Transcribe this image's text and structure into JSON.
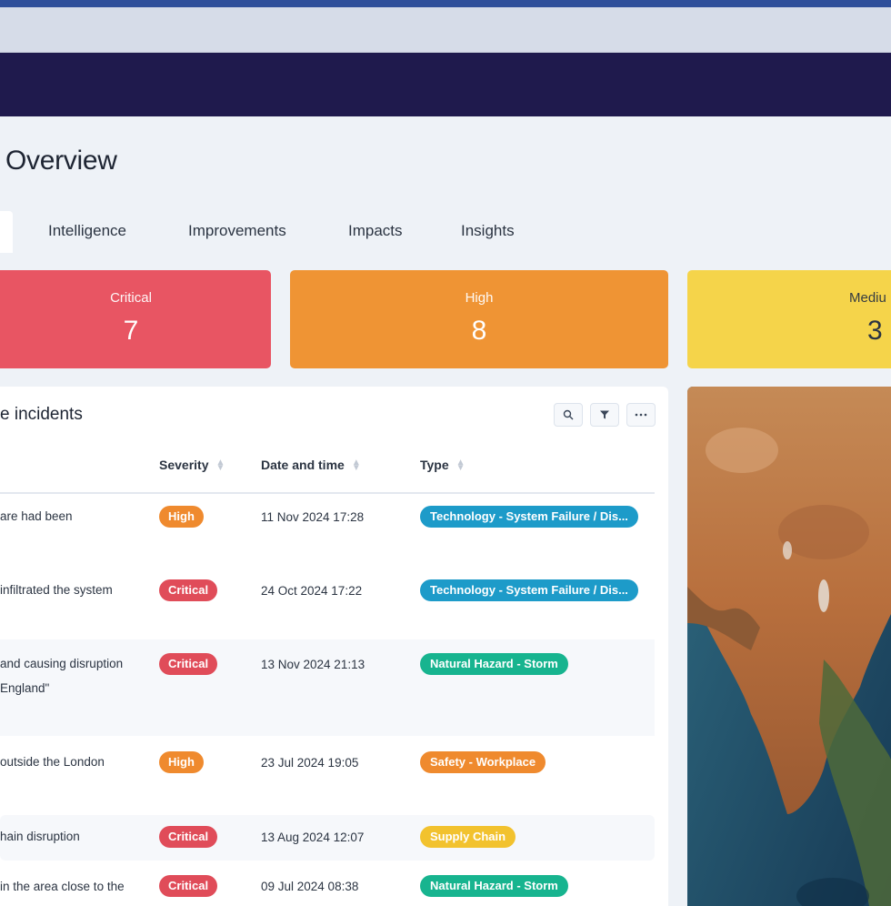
{
  "page": {
    "title": "Overview"
  },
  "tabs": [
    "Intelligence",
    "Improvements",
    "Impacts",
    "Insights"
  ],
  "severity_cards": {
    "critical": {
      "label": "Critical",
      "value": "7",
      "color": "#e85563"
    },
    "high": {
      "label": "High",
      "value": "8",
      "color": "#ef9434"
    },
    "medium": {
      "label": "Mediu",
      "value": "3",
      "color": "#f5d44a"
    }
  },
  "incidents": {
    "title": "e incidents",
    "actions": {
      "search": "search-icon",
      "filter": "filter-icon",
      "more": "more-icon"
    },
    "columns": {
      "severity": "Severity",
      "datetime": "Date and time",
      "type": "Type"
    },
    "rows": [
      {
        "desc1": "are had been",
        "desc2": "",
        "severity": "High",
        "datetime": "11 Nov 2024 17:28",
        "type": "Technology - System Failure / Dis...",
        "type_color": "#1d9bc9"
      },
      {
        "desc1": " infiltrated the system",
        "desc2": "",
        "severity": "Critical",
        "datetime": "24 Oct 2024 17:22",
        "type": "Technology - System Failure / Dis...",
        "type_color": "#1d9bc9"
      },
      {
        "desc1": "and causing disruption",
        "desc2": " England\"",
        "severity": "Critical",
        "datetime": "13 Nov 2024 21:13",
        "type": "Natural Hazard - Storm",
        "type_color": "#17b48f"
      },
      {
        "desc1": " outside the London",
        "desc2": "",
        "severity": "High",
        "datetime": "23 Jul 2024 19:05",
        "type": "Safety - Workplace",
        "type_color": "#ef8a2e"
      },
      {
        "desc1": "hain disruption",
        "desc2": "",
        "severity": "Critical",
        "datetime": "13 Aug 2024 12:07",
        "type": "Supply Chain",
        "type_color": "#f2c22e"
      },
      {
        "desc1": " in the area close to the",
        "desc2": "",
        "severity": "Critical",
        "datetime": "09 Jul 2024 08:38",
        "type": "Natural Hazard - Storm",
        "type_color": "#17b48f"
      }
    ]
  }
}
